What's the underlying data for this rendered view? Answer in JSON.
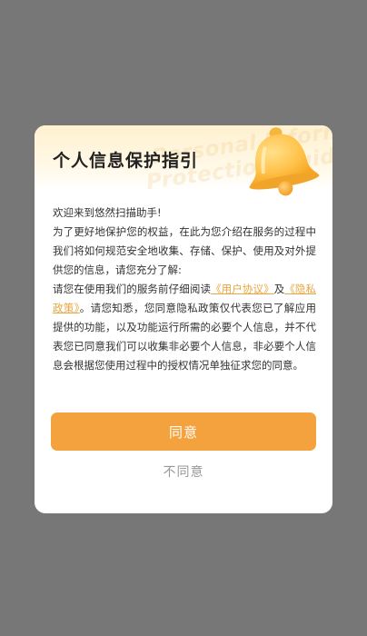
{
  "dialog": {
    "title": "个人信息保护指引",
    "watermark_line1": "Personal Informatio",
    "watermark_line2": "Protection Guidelines",
    "bell_icon": "bell-icon",
    "body": {
      "greeting": "欢迎来到悠然扫描助手!",
      "intro": "为了更好地保护您的权益，在此为您介绍在服务的过程中我们将如何规范安全地收集、存储、保护、使用及对外提供您的信息，请您充分了解:",
      "read_prefix": "请您在使用我们的服务前仔细阅读",
      "user_agreement": "《用户协议》",
      "and": "及",
      "privacy_policy": "《隐私政策》",
      "read_suffix": "。请您知悉，您同意隐私政策仅代表您已了解应用提供的功能，以及功能运行所需的必要个人信息，并不代表您已同意我们可以收集非必要个人信息，非必要个人信息会根据您使用过程中的授权情况单独征求您的同意。"
    },
    "agree_label": "同意",
    "disagree_label": "不同意"
  },
  "colors": {
    "overlay": "#777777",
    "accent": "#f4a23d",
    "link": "#e9a63e",
    "header_bg": "#fff1cf"
  }
}
